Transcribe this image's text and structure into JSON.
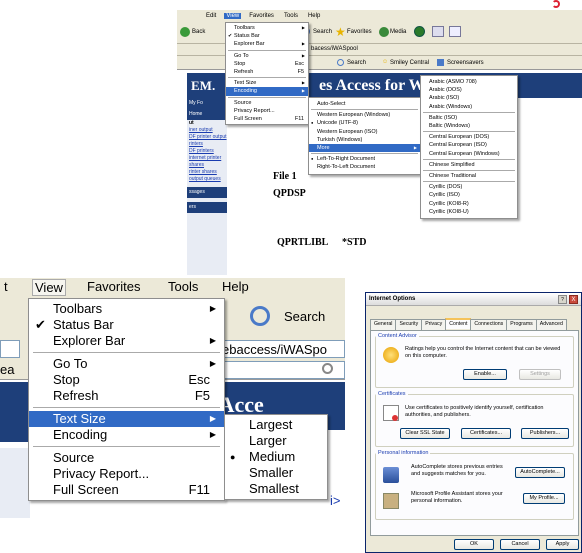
{
  "top_shot": {
    "menubar": [
      "Edit",
      "View",
      "Favorites",
      "Tools",
      "Help"
    ],
    "toolbar": {
      "back": "Back",
      "search": "Search",
      "favorites": "Favorites",
      "media": "Media"
    },
    "address_fragment": "bacess/iWASpool",
    "links_bar": {
      "search": "Search",
      "smiley": "Smiley Central",
      "screensavers": "Screensavers"
    },
    "banner": "es Access for Web",
    "banner_left": "EM.",
    "nav_items": [
      "My Fo",
      "Home",
      "ut",
      "iner output",
      "DF printer output",
      "rinters",
      "DF printers",
      "internet printer shares",
      "rinter shares",
      "output queues",
      "ssages",
      "ers"
    ],
    "file_label": "File 1",
    "qpdsp": "QPDSP",
    "qprtlibl": "QPRTLIBL",
    "std": "*STD",
    "view_menu": [
      {
        "label": "Toolbars",
        "arrow": true
      },
      {
        "label": "Status Bar",
        "check": true
      },
      {
        "label": "Explorer Bar",
        "arrow": true
      },
      {
        "sep": true
      },
      {
        "label": "Go To",
        "arrow": true
      },
      {
        "label": "Stop",
        "key": "Esc"
      },
      {
        "label": "Refresh",
        "key": "F5"
      },
      {
        "sep": true
      },
      {
        "label": "Text Size",
        "arrow": true
      },
      {
        "label": "Encoding",
        "arrow": true,
        "highlight": true
      },
      {
        "sep": true
      },
      {
        "label": "Source"
      },
      {
        "label": "Privacy Report..."
      },
      {
        "label": "Full Screen",
        "key": "F11"
      }
    ],
    "encoding_menu": [
      {
        "label": "Auto-Select"
      },
      {
        "sep": true
      },
      {
        "label": "Western European (Windows)"
      },
      {
        "label": "Unicode (UTF-8)",
        "dot": true
      },
      {
        "label": "Western European (ISO)"
      },
      {
        "label": "Turkish (Windows)"
      },
      {
        "label": "More",
        "arrow": true,
        "highlight": true
      },
      {
        "sep": true
      },
      {
        "label": "Left-To-Right Document",
        "dot": true
      },
      {
        "label": "Right-To-Left Document"
      }
    ],
    "more_menu": [
      "Arabic (ASMO 708)",
      "Arabic (DOS)",
      "Arabic (ISO)",
      "Arabic (Windows)",
      "-",
      "Baltic (ISO)",
      "Baltic (Windows)",
      "-",
      "Central European (DOS)",
      "Central European (ISO)",
      "Central European (Windows)",
      "-",
      "Chinese Simplified",
      "-",
      "Chinese Traditional",
      "-",
      "Cyrillic (DOS)",
      "Cyrillic (ISO)",
      "Cyrillic (KOI8-R)",
      "Cyrillic (KOI8-U)"
    ]
  },
  "bottom_left": {
    "menubar": [
      "t",
      "View",
      "Favorites",
      "Tools",
      "Help"
    ],
    "search": "Search",
    "address": "ebaccess/iWASpo",
    "address_left": "ea",
    "banner": "es Acce",
    "view_menu": [
      {
        "label": "Toolbars",
        "arrow": true
      },
      {
        "label": "Status Bar",
        "check": true
      },
      {
        "label": "Explorer Bar",
        "arrow": true
      },
      {
        "sep": true
      },
      {
        "label": "Go To",
        "arrow": true
      },
      {
        "label": "Stop",
        "key": "Esc"
      },
      {
        "label": "Refresh",
        "key": "F5"
      },
      {
        "sep": true
      },
      {
        "label": "Text Size",
        "arrow": true,
        "highlight": true
      },
      {
        "label": "Encoding",
        "arrow": true
      },
      {
        "sep": true
      },
      {
        "label": "Source"
      },
      {
        "label": "Privacy Report..."
      },
      {
        "label": "Full Screen",
        "key": "F11"
      }
    ],
    "text_size_menu": [
      {
        "label": "Largest"
      },
      {
        "label": "Larger"
      },
      {
        "label": "Medium",
        "dot": true
      },
      {
        "label": "Smaller"
      },
      {
        "label": "Smallest"
      }
    ]
  },
  "internet_options": {
    "title": "Internet Options",
    "help_btn": "?",
    "close_btn": "X",
    "tabs": [
      "General",
      "Security",
      "Privacy",
      "Content",
      "Connections",
      "Programs",
      "Advanced"
    ],
    "active_tab": "Content",
    "content_advisor": {
      "legend": "Content Advisor",
      "text": "Ratings help you control the Internet content that can be viewed on this computer.",
      "enable": "Enable...",
      "settings": "Settings"
    },
    "certificates": {
      "legend": "Certificates",
      "text": "Use certificates to positively identify yourself, certification authorities, and publishers.",
      "clear_ssl": "Clear SSL State",
      "certificates": "Certificates...",
      "publishers": "Publishers..."
    },
    "personal": {
      "legend": "Personal information",
      "autocomplete_text": "AutoComplete stores previous entries and suggests matches for you.",
      "autocomplete_btn": "AutoComplete...",
      "profile_text": "Microsoft Profile Assistant stores your personal information.",
      "profile_btn": "My Profile..."
    },
    "ok": "OK",
    "cancel": "Cancel",
    "apply": "Apply"
  }
}
